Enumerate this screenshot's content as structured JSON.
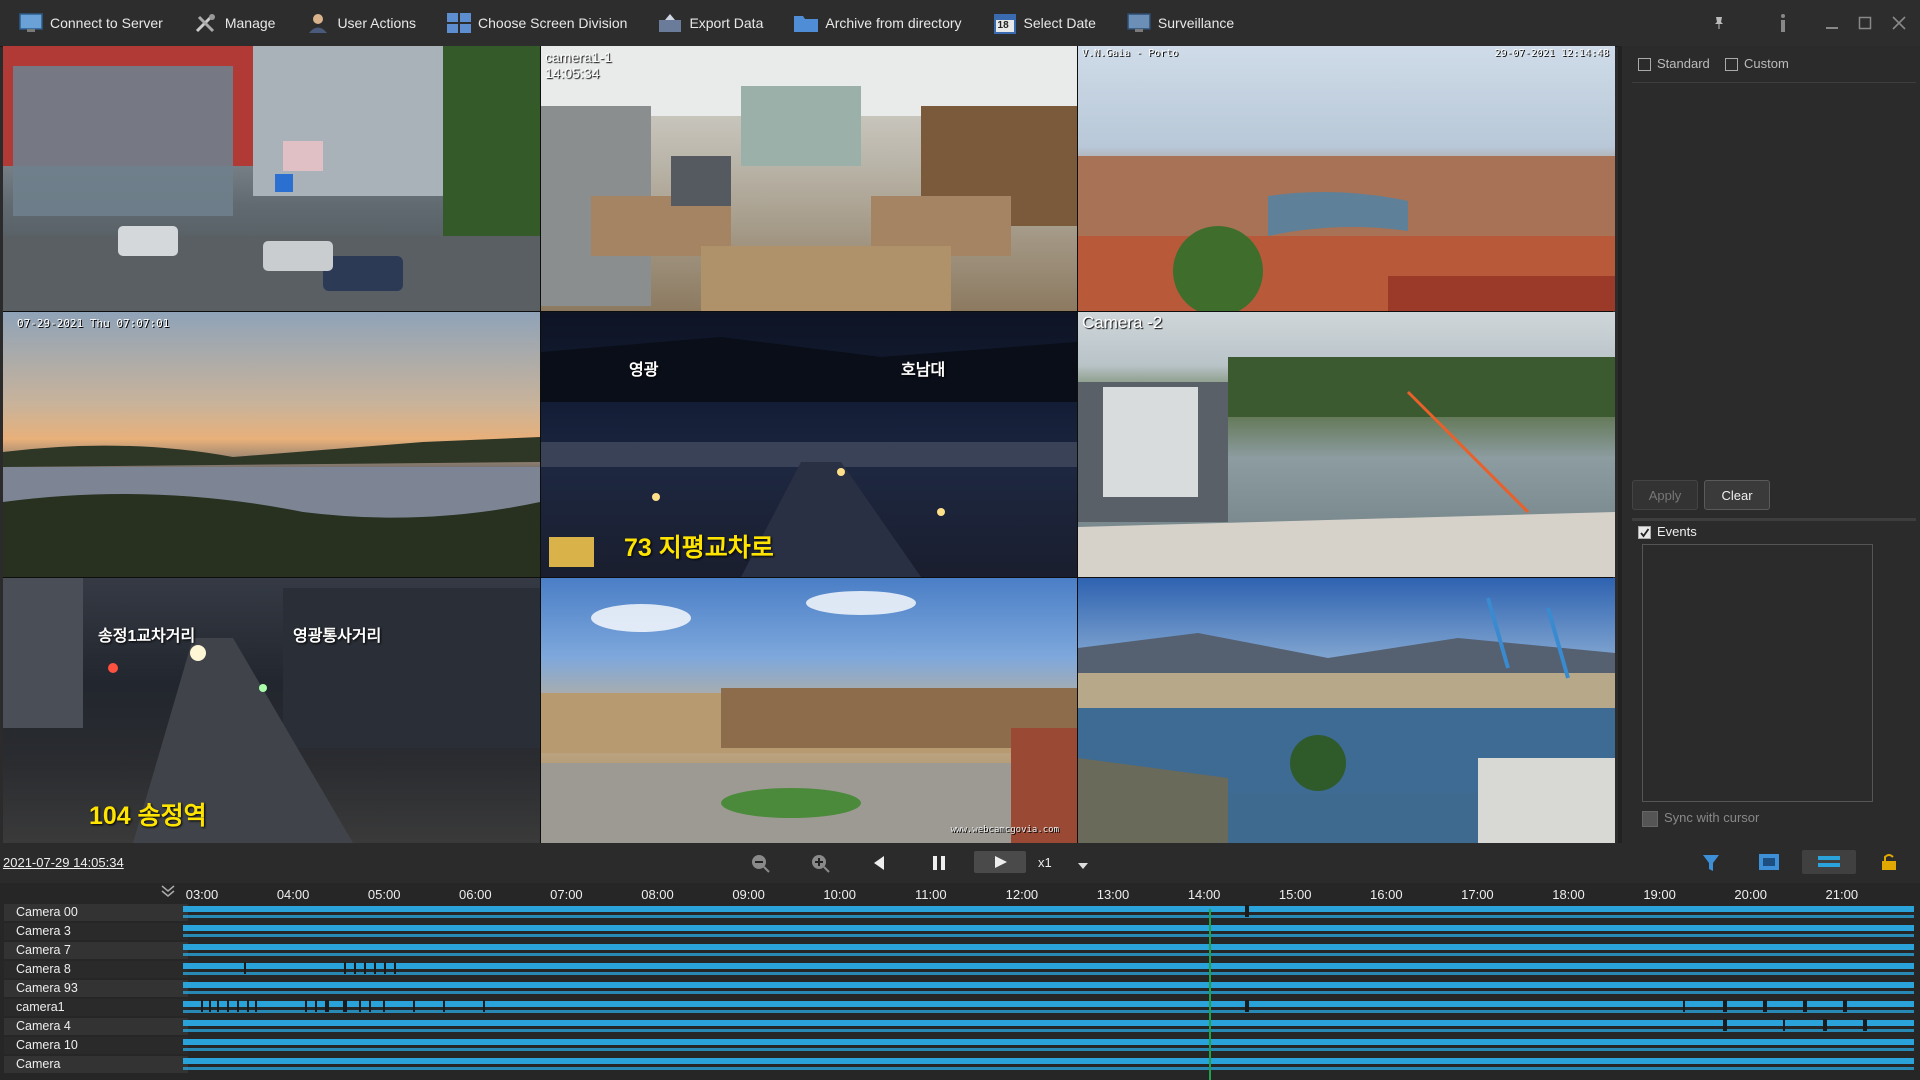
{
  "toolbar": {
    "items": [
      {
        "label": "Connect to Server",
        "icon": "monitor-icon"
      },
      {
        "label": "Manage",
        "icon": "tools-icon"
      },
      {
        "label": "User Actions",
        "icon": "user-icon"
      },
      {
        "label": "Choose Screen Division",
        "icon": "grid-icon"
      },
      {
        "label": "Export Data",
        "icon": "export-icon"
      },
      {
        "label": "Archive from directory",
        "icon": "folder-icon"
      },
      {
        "label": "Select Date",
        "icon": "calendar-icon",
        "badge": "18"
      },
      {
        "label": "Surveillance",
        "icon": "surveillance-icon"
      }
    ]
  },
  "cameras": [
    {
      "id": "cam1",
      "label": "",
      "osd": ""
    },
    {
      "id": "cam2",
      "label": "camera1-1",
      "osd": "14:05:34"
    },
    {
      "id": "cam3",
      "label": "V.N.Gaia - Porto",
      "osd": "29-07-2021 12:14:48"
    },
    {
      "id": "cam4",
      "label": "",
      "osd": "07-29-2021  Thu  07:07:01"
    },
    {
      "id": "cam5",
      "label": "",
      "osd": "",
      "kr_left": "영광",
      "kr_right": "호남대",
      "kr_yellow": "73  지평교차로"
    },
    {
      "id": "cam6",
      "label": "Camera -2",
      "osd": ""
    },
    {
      "id": "cam7",
      "label": "",
      "osd": "",
      "kr_left": "송정1교차거리",
      "kr_right": "영광통사거리",
      "kr_yellow": "104  송정역"
    },
    {
      "id": "cam8",
      "label": "",
      "osd": "www.webcamcgovia.com"
    },
    {
      "id": "cam9",
      "label": "",
      "osd": ""
    }
  ],
  "sidepanel": {
    "standard_label": "Standard",
    "custom_label": "Custom",
    "apply_label": "Apply",
    "clear_label": "Clear",
    "events_label": "Events",
    "sync_label": "Sync with cursor"
  },
  "controls": {
    "current_time": "2021-07-29 14:05:34",
    "speed": "x1"
  },
  "timeline": {
    "hours": [
      "03:00",
      "04:00",
      "05:00",
      "06:00",
      "07:00",
      "08:00",
      "09:00",
      "10:00",
      "11:00",
      "12:00",
      "13:00",
      "14:00",
      "15:00",
      "16:00",
      "17:00",
      "18:00",
      "19:00",
      "20:00",
      "21:00"
    ],
    "cursor_fraction": 0.593,
    "cameras": [
      "Camera 00",
      "Camera 3",
      "Camera 7",
      "Camera 8",
      "Camera 93",
      "camera1",
      "Camera 4",
      "Camera 10",
      "Camera"
    ]
  },
  "colors": {
    "accent": "#29a3d9",
    "background": "#2b2b2b",
    "cursor_line": "#1fa34a"
  }
}
